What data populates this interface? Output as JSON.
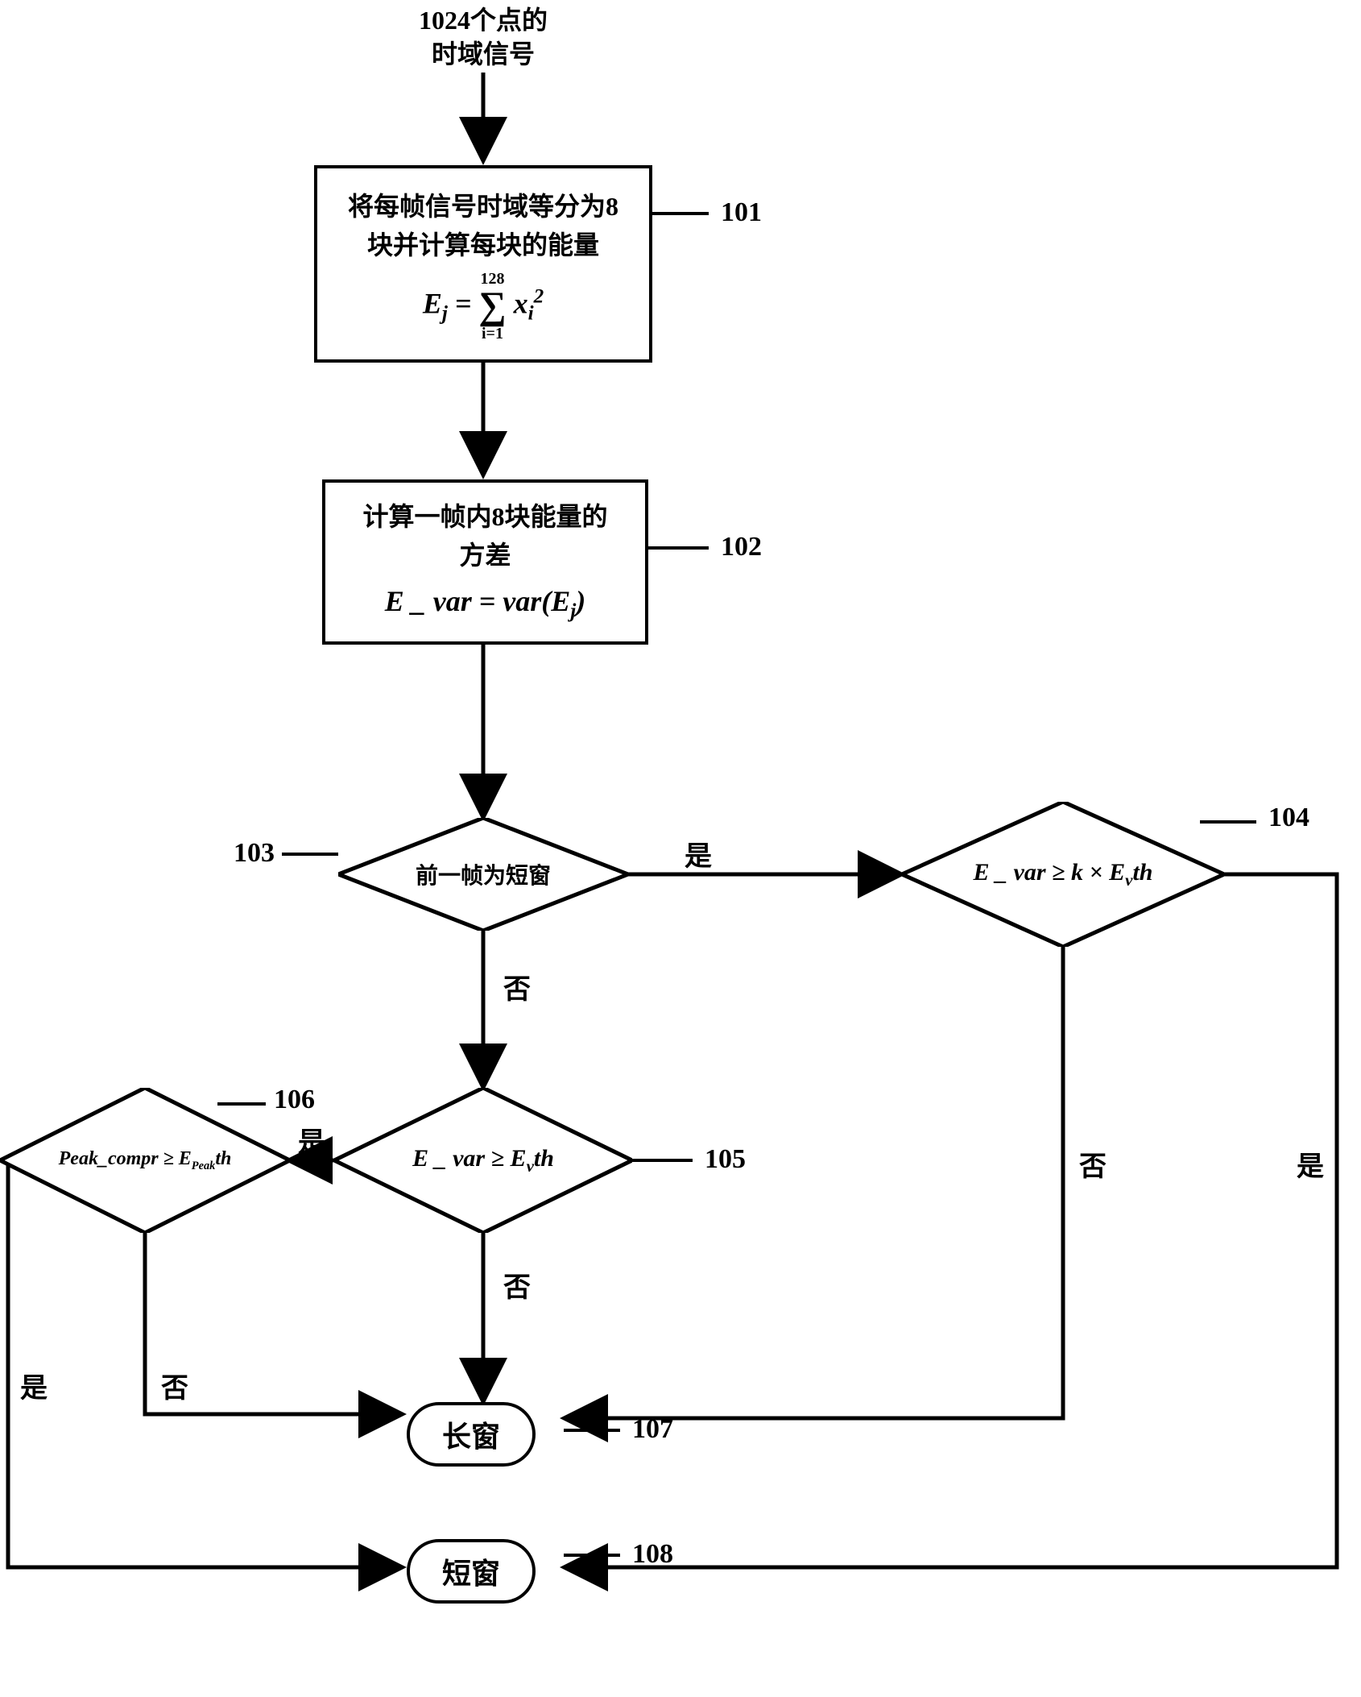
{
  "input": {
    "line1": "1024个点的",
    "line2": "时域信号"
  },
  "node101": {
    "line1": "将每帧信号时域等分为8",
    "line2": "块并计算每块的能量",
    "formula_lhs": "E",
    "formula_sub": "j",
    "formula_eq": " = ",
    "sum_top": "128",
    "sum_bot": "i=1",
    "formula_term": " x",
    "formula_term_sub": "i",
    "formula_term_sup": "2",
    "ref": "101"
  },
  "node102": {
    "line1": "计算一帧内8块能量的",
    "line2": "方差",
    "formula": "E _ var = var(E",
    "formula_sub": "j",
    "formula_close": ")",
    "ref": "102"
  },
  "node103": {
    "text": "前一帧为短窗",
    "ref": "103",
    "yes": "是",
    "no": "否"
  },
  "node104": {
    "formula": "E _ var ≥ k × E",
    "formula_sub": "v",
    "formula_tail": "th",
    "ref": "104",
    "yes": "是",
    "no": "否"
  },
  "node105": {
    "formula": "E _ var ≥ E",
    "formula_sub": "v",
    "formula_tail": "th",
    "ref": "105",
    "yes": "是",
    "no": "否"
  },
  "node106": {
    "formula": "Peak_compr ≥ E",
    "formula_sub": "Peak",
    "formula_tail": "th",
    "ref": "106",
    "yes": "是",
    "no": "否"
  },
  "node107": {
    "text": "长窗",
    "ref": "107"
  },
  "node108": {
    "text": "短窗",
    "ref": "108"
  }
}
